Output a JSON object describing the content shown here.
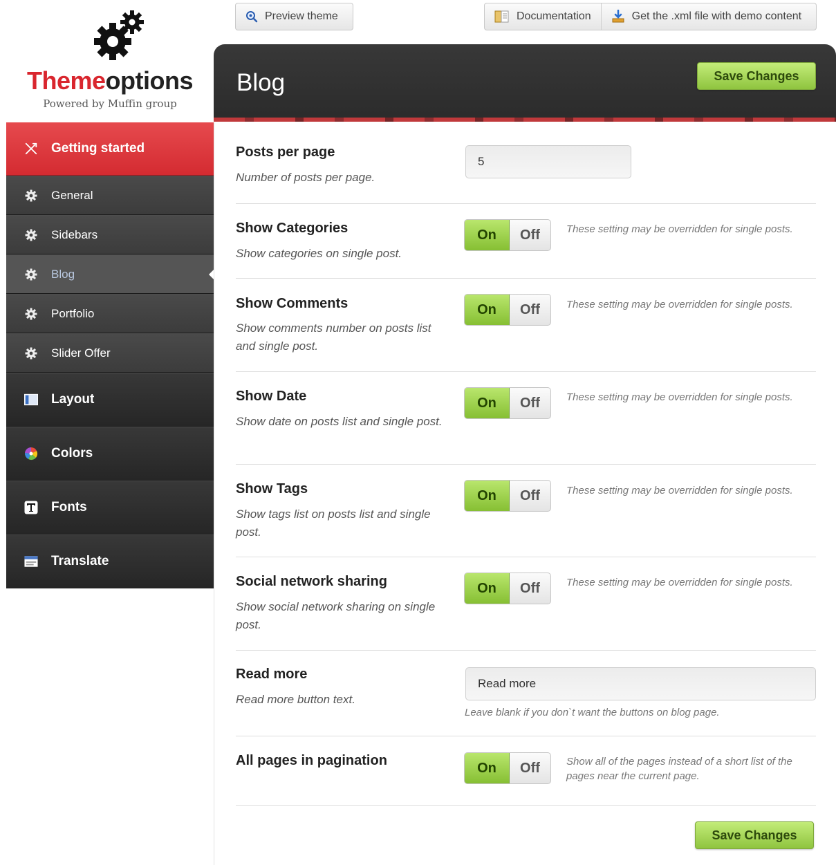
{
  "logo": {
    "title_part1": "Theme",
    "title_part2": "options",
    "subtitle": "Powered by Muffin group",
    "icon": "gears-icon"
  },
  "toolbar": {
    "preview_label": "Preview theme",
    "documentation_label": "Documentation",
    "xml_label": "Get the .xml file with demo content"
  },
  "sidebar": {
    "getting_started": "Getting started",
    "sub_items": [
      {
        "label": "General",
        "icon": "gear-icon"
      },
      {
        "label": "Sidebars",
        "icon": "gear-icon"
      },
      {
        "label": "Blog",
        "icon": "gear-icon",
        "active": true
      },
      {
        "label": "Portfolio",
        "icon": "gear-icon"
      },
      {
        "label": "Slider Offer",
        "icon": "gear-icon"
      }
    ],
    "main_items": [
      {
        "label": "Layout",
        "icon": "layout-icon"
      },
      {
        "label": "Colors",
        "icon": "color-wheel-icon"
      },
      {
        "label": "Fonts",
        "icon": "font-icon"
      },
      {
        "label": "Translate",
        "icon": "translate-icon"
      }
    ]
  },
  "panel": {
    "title": "Blog",
    "save_label": "Save Changes"
  },
  "settings": {
    "posts_per_page": {
      "label": "Posts per page",
      "desc": "Number of posts per page.",
      "value": "5"
    },
    "show_categories": {
      "label": "Show Categories",
      "desc": "Show categories on single post.",
      "on": "On",
      "off": "Off",
      "note": "These setting may be overridden for single posts."
    },
    "show_comments": {
      "label": "Show Comments",
      "desc": "Show comments number on posts list and single post.",
      "on": "On",
      "off": "Off",
      "note": "These setting may be overridden for single posts."
    },
    "show_date": {
      "label": "Show Date",
      "desc": "Show date on posts list and single post.",
      "on": "On",
      "off": "Off",
      "note": "These setting may be overridden for single posts."
    },
    "show_tags": {
      "label": "Show Tags",
      "desc": "Show tags list on posts list and single post.",
      "on": "On",
      "off": "Off",
      "note": "These setting may be overridden for single posts."
    },
    "social_sharing": {
      "label": "Social network sharing",
      "desc": "Show social network sharing on single post.",
      "on": "On",
      "off": "Off",
      "note": "These setting may be overridden for single posts."
    },
    "read_more": {
      "label": "Read more",
      "desc": "Read more button text.",
      "value": "Read more",
      "note": "Leave blank if you don`t want the buttons on blog page."
    },
    "all_pages": {
      "label": "All pages in pagination",
      "on": "On",
      "off": "Off",
      "note": "Show all of the pages instead of a short list of the pages near the current page."
    }
  },
  "colors": {
    "accent_red": "#d9262e",
    "save_green": "#8fc43f",
    "toggle_on_green": "#86bf33",
    "panel_dark": "#2b2b2b"
  }
}
